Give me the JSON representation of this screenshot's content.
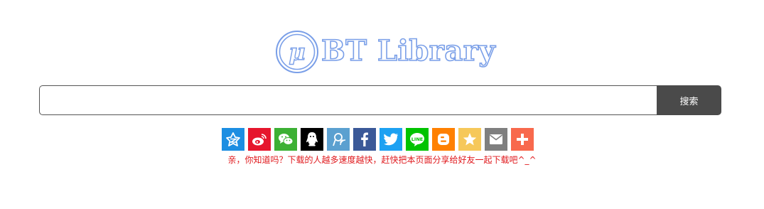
{
  "logo": {
    "mark_char": "μ",
    "text": "BT Library",
    "color": "#7a9fe8"
  },
  "search": {
    "value": "",
    "placeholder": "",
    "button_label": "搜索"
  },
  "share": {
    "items": [
      {
        "icon": "qzone-icon",
        "color": "#1c8ee2"
      },
      {
        "icon": "weibo-icon",
        "color": "#e6162d"
      },
      {
        "icon": "wechat-icon",
        "color": "#3cb034"
      },
      {
        "icon": "qq-icon",
        "color": "#000000"
      },
      {
        "icon": "tqq-icon",
        "color": "#5ba0d0"
      },
      {
        "icon": "facebook-icon",
        "color": "#3b5998"
      },
      {
        "icon": "twitter-icon",
        "color": "#1da1f2"
      },
      {
        "icon": "line-icon",
        "color": "#00c300"
      },
      {
        "icon": "blogger-icon",
        "color": "#ff8000"
      },
      {
        "icon": "favorite-star-icon",
        "color": "#f6c85a"
      },
      {
        "icon": "email-icon",
        "color": "#7f7f7f"
      },
      {
        "icon": "more-plus-icon",
        "color": "#f8694d"
      }
    ],
    "tip": "亲，你知道吗？下载的人越多速度越快，赶快把本页面分享给好友一起下载吧^_^"
  }
}
